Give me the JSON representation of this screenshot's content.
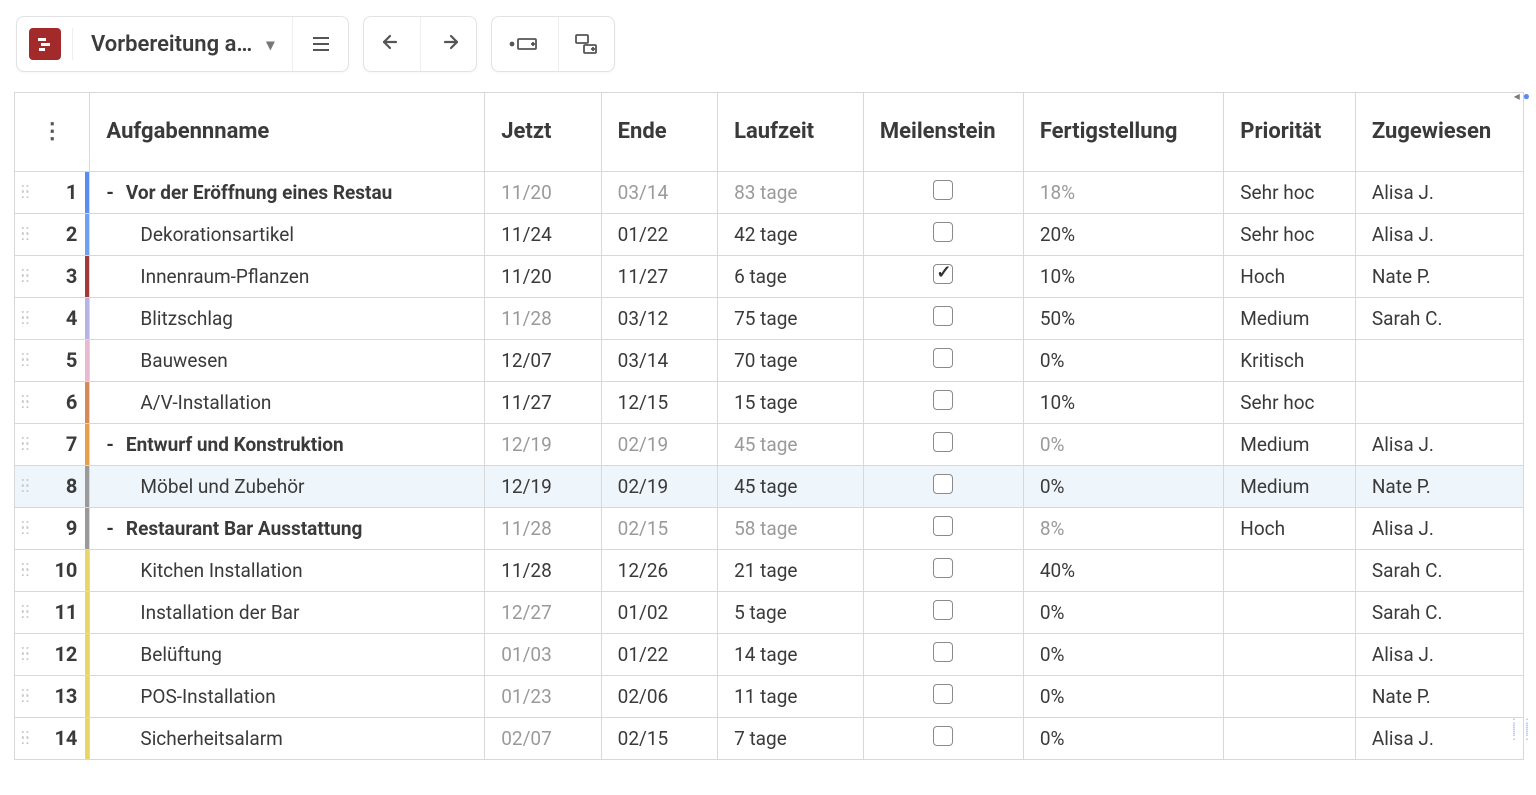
{
  "header": {
    "title": "Vorbereitung a…"
  },
  "columns": {
    "name": "Aufgabennname",
    "jetzt": "Jetzt",
    "ende": "Ende",
    "laufzeit": "Laufzeit",
    "meilenstein": "Meilenstein",
    "fertigstellung": "Fertigstellung",
    "prioritaet": "Priorität",
    "zugewiesen": "Zugewiesen"
  },
  "rows": [
    {
      "num": "1",
      "color": "#5b8def",
      "group": true,
      "name": "Vor der Eröffnung eines Restau",
      "jetzt": "11/20",
      "jetzt_muted": true,
      "ende": "03/14",
      "ende_muted": true,
      "lauf": "83 tage",
      "lauf_muted": true,
      "mchecked": false,
      "fertig": "18%",
      "fertig_muted": true,
      "prior": "Sehr hoc",
      "zug": "Alisa J."
    },
    {
      "num": "2",
      "color": "#6ea2ef",
      "group": false,
      "name": "Dekorationsartikel",
      "jetzt": "11/24",
      "jetzt_muted": false,
      "ende": "01/22",
      "ende_muted": false,
      "lauf": "42 tage",
      "lauf_muted": false,
      "mchecked": false,
      "fertig": "20%",
      "fertig_muted": false,
      "prior": "Sehr hoc",
      "zug": "Alisa J."
    },
    {
      "num": "3",
      "color": "#a33a3a",
      "group": false,
      "name": "Innenraum-Pflanzen",
      "jetzt": "11/20",
      "jetzt_muted": false,
      "ende": "11/27",
      "ende_muted": false,
      "lauf": "6 tage",
      "lauf_muted": false,
      "mchecked": true,
      "fertig": "10%",
      "fertig_muted": false,
      "prior": "Hoch",
      "zug": "Nate P."
    },
    {
      "num": "4",
      "color": "#b7b3e6",
      "group": false,
      "name": "Blitzschlag",
      "jetzt": "11/28",
      "jetzt_muted": true,
      "ende": "03/12",
      "ende_muted": false,
      "lauf": "75 tage",
      "lauf_muted": false,
      "mchecked": false,
      "fertig": "50%",
      "fertig_muted": false,
      "prior": "Medium",
      "zug": "Sarah C."
    },
    {
      "num": "5",
      "color": "#e9b9d2",
      "group": false,
      "name": "Bauwesen",
      "jetzt": "12/07",
      "jetzt_muted": false,
      "ende": "03/14",
      "ende_muted": false,
      "lauf": "70 tage",
      "lauf_muted": false,
      "mchecked": false,
      "fertig": "0%",
      "fertig_muted": false,
      "prior": "Kritisch",
      "zug": ""
    },
    {
      "num": "6",
      "color": "#d68a59",
      "group": false,
      "name": "A/V-Installation",
      "jetzt": "11/27",
      "jetzt_muted": false,
      "ende": "12/15",
      "ende_muted": false,
      "lauf": "15 tage",
      "lauf_muted": false,
      "mchecked": false,
      "fertig": "10%",
      "fertig_muted": false,
      "prior": "Sehr hoc",
      "zug": ""
    },
    {
      "num": "7",
      "color": "#e6a04a",
      "group": true,
      "name": "Entwurf und Konstruktion",
      "jetzt": "12/19",
      "jetzt_muted": true,
      "ende": "02/19",
      "ende_muted": true,
      "lauf": "45 tage",
      "lauf_muted": true,
      "mchecked": false,
      "fertig": "0%",
      "fertig_muted": true,
      "prior": "Medium",
      "zug": "Alisa J."
    },
    {
      "num": "8",
      "color": "#9a9a9a",
      "group": false,
      "selected": true,
      "name": "Möbel und Zubehör",
      "jetzt": "12/19",
      "jetzt_muted": false,
      "ende": "02/19",
      "ende_muted": false,
      "lauf": "45 tage",
      "lauf_muted": false,
      "mchecked": false,
      "fertig": "0%",
      "fertig_muted": false,
      "prior": "Medium",
      "zug": "Nate P."
    },
    {
      "num": "9",
      "color": "#9a9a9a",
      "group": true,
      "name": "Restaurant Bar Ausstattung",
      "jetzt": "11/28",
      "jetzt_muted": true,
      "ende": "02/15",
      "ende_muted": true,
      "lauf": "58 tage",
      "lauf_muted": true,
      "mchecked": false,
      "fertig": "8%",
      "fertig_muted": true,
      "prior": "Hoch",
      "zug": "Alisa J."
    },
    {
      "num": "10",
      "color": "#e9d66b",
      "group": false,
      "name": "Kitchen Installation",
      "jetzt": "11/28",
      "jetzt_muted": false,
      "ende": "12/26",
      "ende_muted": false,
      "lauf": "21 tage",
      "lauf_muted": false,
      "mchecked": false,
      "fertig": "40%",
      "fertig_muted": false,
      "prior": "",
      "zug": "Sarah C."
    },
    {
      "num": "11",
      "color": "#e9d66b",
      "group": false,
      "name": "Installation der Bar",
      "jetzt": "12/27",
      "jetzt_muted": true,
      "ende": "01/02",
      "ende_muted": false,
      "lauf": "5 tage",
      "lauf_muted": false,
      "mchecked": false,
      "fertig": "0%",
      "fertig_muted": false,
      "prior": "",
      "zug": "Sarah C."
    },
    {
      "num": "12",
      "color": "#e9d66b",
      "group": false,
      "name": "Belüftung",
      "jetzt": "01/03",
      "jetzt_muted": true,
      "ende": "01/22",
      "ende_muted": false,
      "lauf": "14 tage",
      "lauf_muted": false,
      "mchecked": false,
      "fertig": "0%",
      "fertig_muted": false,
      "prior": "",
      "zug": "Alisa J."
    },
    {
      "num": "13",
      "color": "#e9d66b",
      "group": false,
      "name": "POS-Installation",
      "jetzt": "01/23",
      "jetzt_muted": true,
      "ende": "02/06",
      "ende_muted": false,
      "lauf": "11 tage",
      "lauf_muted": false,
      "mchecked": false,
      "fertig": "0%",
      "fertig_muted": false,
      "prior": "",
      "zug": "Nate P."
    },
    {
      "num": "14",
      "color": "#e9d66b",
      "group": false,
      "name": "Sicherheitsalarm",
      "jetzt": "02/07",
      "jetzt_muted": true,
      "ende": "02/15",
      "ende_muted": false,
      "lauf": "7 tage",
      "lauf_muted": false,
      "mchecked": false,
      "fertig": "0%",
      "fertig_muted": false,
      "prior": "",
      "zug": "Alisa J."
    }
  ]
}
